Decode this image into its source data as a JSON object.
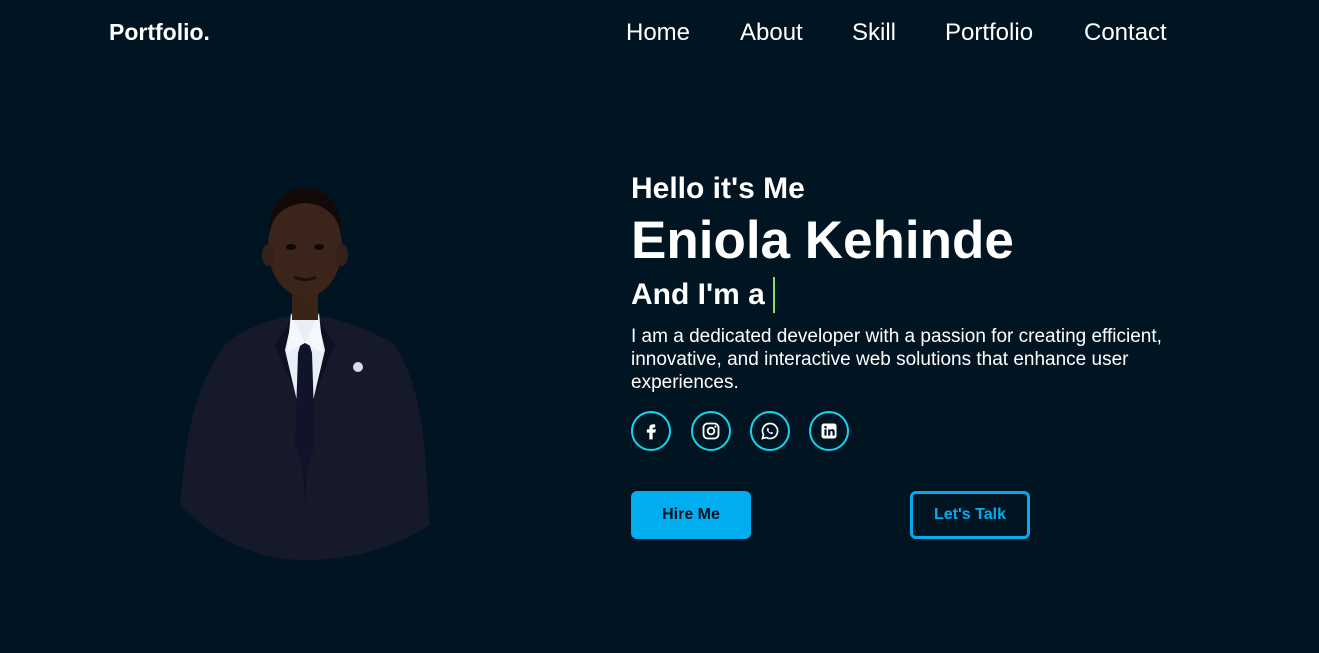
{
  "header": {
    "logo": "Portfolio.",
    "nav": [
      {
        "label": "Home"
      },
      {
        "label": "About"
      },
      {
        "label": "Skill"
      },
      {
        "label": "Portfolio"
      },
      {
        "label": "Contact"
      }
    ]
  },
  "hero": {
    "greeting": "Hello it's Me",
    "name": "Eniola Kehinde",
    "role_prefix": "And I'm a",
    "description": "I am a dedicated developer with a passion for creating efficient, innovative, and interactive web solutions that enhance user experiences.",
    "socials": [
      {
        "icon": "facebook-icon"
      },
      {
        "icon": "instagram-icon"
      },
      {
        "icon": "whatsapp-icon"
      },
      {
        "icon": "linkedin-icon"
      }
    ],
    "buttons": {
      "hire": "Hire Me",
      "talk": "Let's Talk"
    }
  },
  "colors": {
    "background": "#011421",
    "accent": "#00aef0",
    "icon_accent": "#10d7f0",
    "cursor": "#7fe36a"
  }
}
